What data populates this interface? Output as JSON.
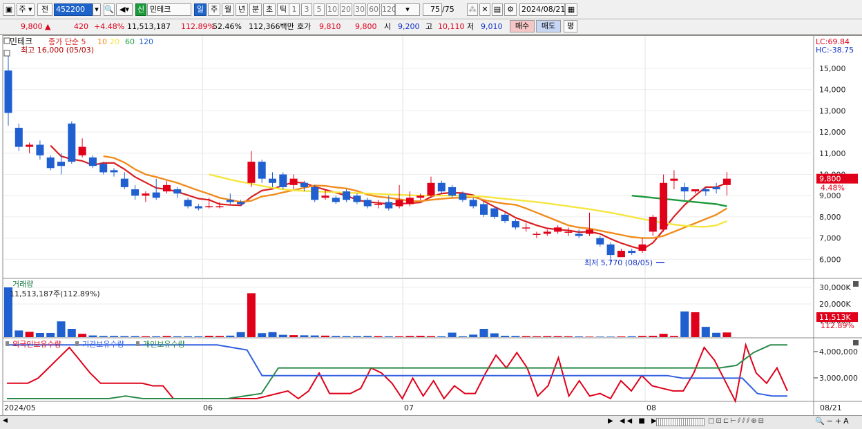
{
  "toolbar": {
    "market_label": "주",
    "prev_label": "전",
    "code": "452200",
    "type_badge": "신",
    "stock_name": "민테크",
    "periods": [
      "일",
      "주",
      "월",
      "년",
      "분",
      "초",
      "틱"
    ],
    "selected_period": "일",
    "minutes": [
      "1",
      "3",
      "5",
      "10",
      "20",
      "30",
      "60",
      "120"
    ],
    "count": "75",
    "count_total": "/75",
    "date": "2024/08/21"
  },
  "quote": {
    "price": "9,800",
    "change": "420",
    "change_pct": "+4.48%",
    "volume": "11,513,187",
    "volume_ratio": "112.89%",
    "turnover": "52.46%",
    "amount": "112,366백만",
    "ask_label": "호가",
    "ask1": "9,810",
    "ask2": "9,800",
    "open_label": "시",
    "open": "9,200",
    "high_label": "고",
    "high": "10,110",
    "low_label": "저",
    "low": "9,010",
    "buy_label": "매수",
    "sell_label": "매도",
    "eval_label": "평"
  },
  "price_panel": {
    "stock_name": "민테크",
    "ma_label": "종가 단순",
    "ma_periods": [
      "5",
      "10",
      "20",
      "60",
      "120"
    ],
    "ma_colors": [
      "#d81f1f",
      "#f08c1c",
      "#f5e640",
      "#1a9a3a",
      "#1f5fd0"
    ],
    "high_note": "최고 16,000 (05/03)",
    "low_note": "최저 5,770 (08/05)",
    "lc": "LC:69.84",
    "hc": "HC:-38.75",
    "y_ticks": [
      "15,000",
      "14,000",
      "13,000",
      "12,000",
      "11,000",
      "10,000",
      "9,000",
      "8,000",
      "7,000",
      "6,000"
    ],
    "last_price": "9,800",
    "last_pct": "4.48%"
  },
  "volume_panel": {
    "title": "거래량",
    "info": "11,513,187주(112.89%)",
    "y_ticks": [
      "30,000K",
      "20,000K",
      "10,000K"
    ],
    "last_volume": "11,513K",
    "last_pct": "112.89%"
  },
  "holdings_panel": {
    "legend": [
      "외국인보유수량",
      "기관보유수량",
      "개인보유수량"
    ],
    "y_ticks": [
      "4,000,000",
      "3,000,000"
    ]
  },
  "x_axis": [
    "2024/05",
    "06",
    "07",
    "08",
    "08/21"
  ],
  "colors": {
    "up": "#e0001a",
    "down": "#1f5fd0",
    "selected": "#1e63c9"
  },
  "chart_data": {
    "type": "candlestick",
    "open": [
      14900,
      12200,
      11300,
      11400,
      10800,
      10600,
      12400,
      10900,
      10800,
      10500,
      10200,
      9800,
      9300,
      9000,
      9150,
      9200,
      9300,
      8800,
      8500,
      8500,
      8450,
      8800,
      8700,
      9600,
      10600,
      9800,
      10000,
      9500,
      9600,
      9400,
      8900,
      8900,
      9200,
      9000,
      8800,
      8600,
      8700,
      8500,
      8600,
      8900,
      9000,
      9600,
      9400,
      9100,
      8800,
      8600,
      8400,
      8100,
      7800,
      7500,
      7200,
      7200,
      7300,
      7300,
      7200,
      7200,
      7000,
      6700,
      6100,
      6400,
      6400,
      7300,
      7400,
      9700,
      9400,
      9200,
      9300,
      9400,
      9500
    ],
    "close": [
      12900,
      11300,
      11400,
      10900,
      10300,
      10400,
      10600,
      11300,
      10400,
      10100,
      10100,
      9400,
      9000,
      9100,
      8900,
      9500,
      9100,
      8500,
      8400,
      8500,
      8500,
      8700,
      8600,
      10600,
      9800,
      9600,
      9400,
      9800,
      9400,
      8800,
      9000,
      8700,
      8800,
      8700,
      8500,
      8600,
      8400,
      8800,
      8900,
      9000,
      9600,
      9200,
      9000,
      8800,
      8500,
      8100,
      8000,
      7800,
      7500,
      7500,
      7200,
      7300,
      7500,
      7300,
      7100,
      7400,
      6700,
      6200,
      6400,
      6300,
      6700,
      8000,
      9600,
      9800,
      9200,
      9300,
      9200,
      9300,
      9800
    ],
    "high": [
      15600,
      12400,
      11500,
      11600,
      10900,
      11000,
      12500,
      11700,
      10900,
      10600,
      10300,
      10100,
      9500,
      9200,
      9800,
      9700,
      9400,
      8900,
      8600,
      8900,
      8700,
      9100,
      8800,
      11100,
      10700,
      10100,
      10100,
      10000,
      9700,
      9500,
      9300,
      9000,
      9300,
      9100,
      8900,
      8800,
      9000,
      9500,
      9200,
      9100,
      9900,
      9700,
      9500,
      9200,
      8900,
      8700,
      8500,
      8200,
      7900,
      7700,
      7300,
      7400,
      7600,
      7500,
      7400,
      8200,
      7100,
      6800,
      6500,
      6500,
      7000,
      8100,
      10000,
      10200,
      9600,
      9300,
      9400,
      9600,
      10110
    ],
    "low": [
      12300,
      11100,
      11000,
      10700,
      10200,
      10000,
      10500,
      10800,
      10300,
      10000,
      9900,
      9300,
      8800,
      8700,
      8800,
      9100,
      8900,
      8400,
      8300,
      8400,
      8400,
      8600,
      8500,
      9400,
      9600,
      9400,
      9300,
      9300,
      9200,
      8700,
      8800,
      8600,
      8700,
      8600,
      8400,
      8400,
      8300,
      8400,
      8500,
      8800,
      8900,
      9100,
      8900,
      8700,
      8400,
      8000,
      7900,
      7700,
      7400,
      7300,
      7000,
      7100,
      7200,
      7100,
      7000,
      7100,
      6600,
      5770,
      6100,
      6200,
      6300,
      7100,
      7300,
      9300,
      8800,
      9100,
      9000,
      9100,
      9010
    ],
    "ma5": [
      null,
      null,
      null,
      null,
      11360,
      10860,
      10720,
      10640,
      10440,
      10540,
      10540,
      10240,
      9880,
      9620,
      9360,
      9300,
      9180,
      9020,
      8860,
      8800,
      8600,
      8560,
      8540,
      8940,
      9240,
      9320,
      9480,
      9640,
      9600,
      9420,
      9280,
      9140,
      9000,
      8800,
      8700,
      8660,
      8600,
      8620,
      8640,
      8680,
      8940,
      9100,
      9140,
      9120,
      9020,
      8740,
      8480,
      8240,
      7960,
      7780,
      7600,
      7460,
      7400,
      7360,
      7280,
      7300,
      7200,
      6960,
      6760,
      6600,
      6460,
      6780,
      7380,
      8020,
      8560,
      9000,
      9400,
      9400,
      9600
    ],
    "ma10": [
      null,
      null,
      null,
      null,
      null,
      null,
      null,
      null,
      null,
      10860,
      10780,
      10560,
      10240,
      10000,
      9880,
      9740,
      9600,
      9420,
      9240,
      9080,
      8900,
      8800,
      8700,
      8760,
      8960,
      9040,
      9150,
      9260,
      9370,
      9480,
      9460,
      9390,
      9340,
      9220,
      9050,
      8950,
      8900,
      8830,
      8750,
      8740,
      8800,
      8850,
      8890,
      8910,
      8940,
      8790,
      8700,
      8620,
      8570,
      8400,
      8200,
      8000,
      7800,
      7600,
      7500,
      7450,
      7350,
      7250,
      7150,
      7050,
      7000,
      7000,
      7100,
      7300,
      7500,
      7700,
      7900,
      8100,
      8400
    ],
    "ma20": [
      null,
      null,
      null,
      null,
      null,
      null,
      null,
      null,
      null,
      null,
      null,
      null,
      null,
      null,
      null,
      null,
      null,
      null,
      null,
      10000,
      9880,
      9760,
      9650,
      9560,
      9460,
      9370,
      9300,
      9250,
      9220,
      9200,
      9180,
      9160,
      9140,
      9120,
      9100,
      9080,
      9060,
      9040,
      9020,
      9000,
      9000,
      9000,
      9000,
      9000,
      8980,
      8950,
      8900,
      8850,
      8800,
      8750,
      8700,
      8640,
      8570,
      8500,
      8430,
      8360,
      8280,
      8200,
      8100,
      8000,
      7900,
      7800,
      7720,
      7640,
      7580,
      7540,
      7530,
      7600,
      7800
    ],
    "ma60": [
      null,
      null,
      null,
      null,
      null,
      null,
      null,
      null,
      null,
      null,
      null,
      null,
      null,
      null,
      null,
      null,
      null,
      null,
      null,
      null,
      null,
      null,
      null,
      null,
      null,
      null,
      null,
      null,
      null,
      null,
      null,
      null,
      null,
      null,
      null,
      null,
      null,
      null,
      null,
      null,
      null,
      null,
      null,
      null,
      null,
      null,
      null,
      null,
      null,
      null,
      null,
      null,
      null,
      null,
      null,
      null,
      null,
      null,
      null,
      9000,
      8950,
      8900,
      8850,
      8800,
      8750,
      8700,
      8650,
      8600,
      8500
    ],
    "volume_k": [
      30000,
      4000,
      3200,
      2500,
      2500,
      9500,
      5000,
      2000,
      1000,
      700,
      700,
      600,
      600,
      500,
      500,
      700,
      500,
      500,
      500,
      800,
      700,
      900,
      3000,
      26500,
      2400,
      3000,
      1400,
      1200,
      1100,
      1000,
      900,
      700,
      600,
      600,
      700,
      600,
      500,
      500,
      700,
      800,
      600,
      500,
      2700,
      500,
      1500,
      5000,
      2300,
      800,
      700,
      600,
      500,
      600,
      600,
      500,
      400,
      300,
      300,
      300,
      400,
      500,
      700,
      800,
      2000,
      700,
      15500,
      15000,
      6200,
      2600,
      2800,
      11513
    ],
    "foreign": [
      2.6,
      2.6,
      2.6,
      2.8,
      3.2,
      3.6,
      4.0,
      3.5,
      3.0,
      2.6,
      2.6,
      2.6,
      2.6,
      2.6,
      2.5,
      2.5,
      2.0,
      2.0,
      2.0,
      2.0,
      2.0,
      2.0,
      2.0,
      2.0,
      2.0,
      2.1,
      2.2,
      2.3,
      2.0,
      2.3,
      3.0,
      2.2,
      2.2,
      2.2,
      2.4,
      3.2,
      3.0,
      2.6,
      2.0,
      2.8,
      2.1,
      2.7,
      2.0,
      2.5,
      2.2,
      2.2,
      3.0,
      3.7,
      3.2,
      3.8,
      3.2,
      2.1,
      2.5,
      3.6,
      2.1,
      2.7,
      2.1,
      2.2,
      2.0,
      2.7,
      2.3,
      2.9,
      2.5,
      2.4,
      2.3,
      2.3,
      3.0,
      4.0,
      3.5,
      2.7,
      1.9,
      4.1,
      3.0,
      2.6,
      3.2,
      2.3
    ],
    "institution": [
      4.1,
      4.1,
      4.1,
      4.1,
      4.1,
      4.1,
      4.1,
      4.1,
      4.1,
      4.1,
      4.1,
      4.1,
      4.1,
      4.1,
      4.1,
      4.0,
      3.9,
      2.9,
      2.9,
      2.9,
      2.9,
      2.9,
      2.9,
      2.9,
      2.9,
      2.9,
      2.9,
      2.9,
      2.9,
      2.9,
      2.9,
      2.9,
      2.9,
      2.9,
      2.9,
      2.9,
      2.9,
      2.9,
      2.9,
      2.9,
      2.9,
      2.9,
      2.9,
      2.9,
      2.9,
      2.8,
      2.8,
      2.8,
      2.8,
      2.8,
      2.2,
      2.1,
      2.1
    ],
    "individual": [
      2.0,
      2.0,
      2.0,
      2.0,
      2.0,
      2.0,
      2.0,
      2.1,
      2.0,
      2.0,
      2.0,
      2.0,
      2.0,
      2.0,
      2.1,
      2.2,
      3.2,
      3.2,
      3.2,
      3.2,
      3.2,
      3.2,
      3.2,
      3.2,
      3.2,
      3.2,
      3.2,
      3.2,
      3.2,
      3.2,
      3.2,
      3.2,
      3.2,
      3.2,
      3.2,
      3.2,
      3.2,
      3.2,
      3.2,
      3.2,
      3.2,
      3.2,
      3.2,
      3.3,
      3.8,
      4.1,
      4.1
    ]
  }
}
